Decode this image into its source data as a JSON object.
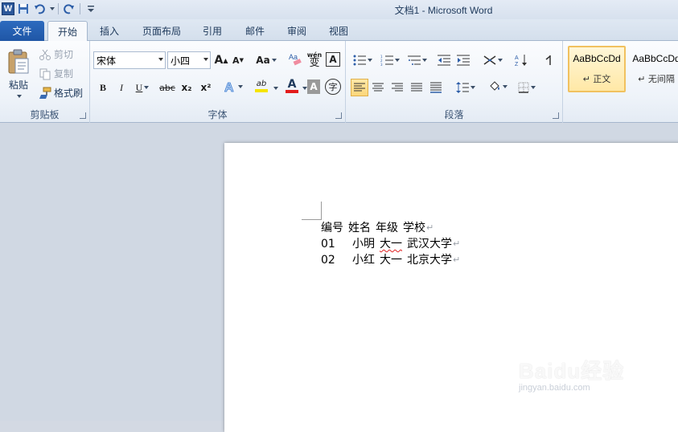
{
  "window": {
    "title": "文档1 - Microsoft Word"
  },
  "quick_access": {
    "logo": "W",
    "items": [
      "save-icon",
      "undo-icon",
      "redo-icon",
      "customize-icon"
    ]
  },
  "tabs": [
    {
      "label": "文件"
    },
    {
      "label": "开始"
    },
    {
      "label": "插入"
    },
    {
      "label": "页面布局"
    },
    {
      "label": "引用"
    },
    {
      "label": "邮件"
    },
    {
      "label": "审阅"
    },
    {
      "label": "视图"
    }
  ],
  "clipboard": {
    "group_label": "剪贴板",
    "paste": "粘贴",
    "cut": "剪切",
    "copy": "复制",
    "format_painter": "格式刷"
  },
  "font": {
    "group_label": "字体",
    "font_name": "宋体",
    "font_size": "小四",
    "grow": "A",
    "shrink": "A",
    "change_case": "Aa",
    "bold": "B",
    "italic": "I",
    "underline": "U",
    "strikethrough": "abc",
    "subscript": "x₂",
    "superscript": "x²",
    "highlight_label": "ab",
    "font_color_label": "A",
    "shade_label": "A",
    "enclose": "字",
    "phonetic": "wén",
    "phonetic_base": "变",
    "clear_format": "A"
  },
  "paragraph": {
    "group_label": "段落"
  },
  "styles": {
    "items": [
      {
        "sample": "AaBbCcDd",
        "name": "↵ 正文"
      },
      {
        "sample": "AaBbCcDd",
        "name": "↵ 无间隔"
      }
    ]
  },
  "colors": {
    "highlight": "#f5e400",
    "font_color": "#e31b1b",
    "accent": "#2b579a"
  },
  "document": {
    "rows": [
      [
        "编号",
        "姓名",
        "年级",
        "学校"
      ],
      [
        "01",
        "小明",
        "大一",
        "武汉大学"
      ],
      [
        "02",
        "小红",
        "大一",
        "北京大学"
      ]
    ],
    "paragraph_mark": "↵"
  },
  "watermark": {
    "brand": "Baidu经验",
    "url": "jingyan.baidu.com"
  }
}
